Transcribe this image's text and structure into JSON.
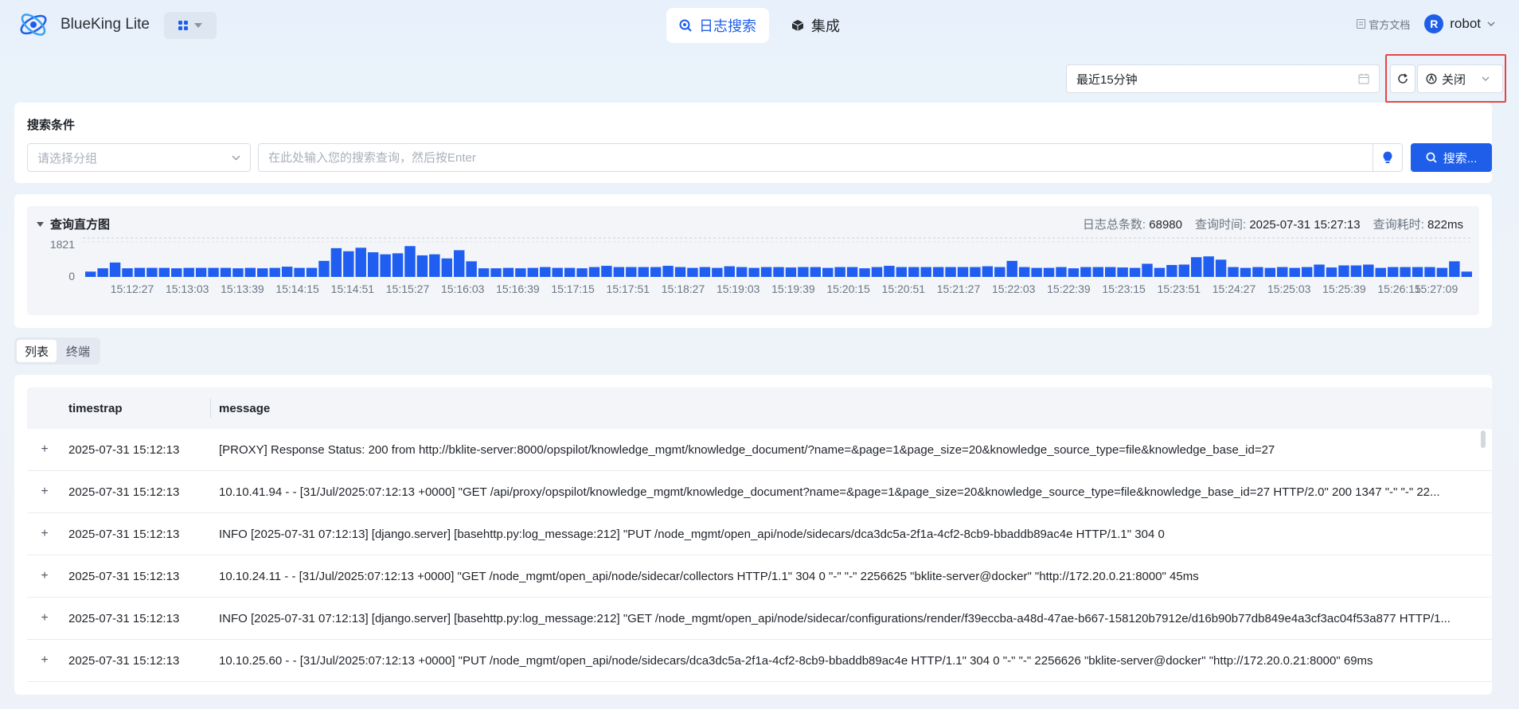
{
  "brand": {
    "name": "BlueKing Lite"
  },
  "nav": [
    {
      "label": "日志搜索",
      "icon": "search-log-icon",
      "active": true
    },
    {
      "label": "集成",
      "icon": "cube-icon",
      "active": false
    }
  ],
  "top_right": {
    "doc_label": "官方文档",
    "user_initial": "R",
    "user_name": "robot"
  },
  "time_range": {
    "value": "最近15分钟"
  },
  "auto_refresh": {
    "value": "关闭"
  },
  "search": {
    "title": "搜索条件",
    "group_placeholder": "请选择分组",
    "query_placeholder": "在此处输入您的搜索查询，然后按Enter",
    "button_label": "搜索..."
  },
  "histogram": {
    "title": "查询直方图",
    "total_label": "日志总条数:",
    "total_value": "68980",
    "query_time_label": "查询时间:",
    "query_time_value": "2025-07-31 15:27:13",
    "elapsed_label": "查询耗时:",
    "elapsed_value": "822ms",
    "y_max_label": "1821",
    "y_min_label": "0"
  },
  "chart_data": {
    "type": "bar",
    "ylim": [
      0,
      1821
    ],
    "x_tick_labels": [
      "15:12:27",
      "15:13:03",
      "15:13:39",
      "15:14:15",
      "15:14:51",
      "15:15:27",
      "15:16:03",
      "15:16:39",
      "15:17:15",
      "15:17:51",
      "15:18:27",
      "15:19:03",
      "15:19:39",
      "15:20:15",
      "15:20:51",
      "15:21:27",
      "15:22:03",
      "15:22:39",
      "15:23:15",
      "15:23:51",
      "15:24:27",
      "15:25:03",
      "15:25:39",
      "15:26:15",
      "15:27:09"
    ],
    "values": [
      260,
      420,
      700,
      420,
      440,
      440,
      440,
      420,
      440,
      440,
      440,
      440,
      420,
      440,
      420,
      440,
      500,
      440,
      440,
      780,
      1400,
      1250,
      1420,
      1200,
      1100,
      1150,
      1500,
      1050,
      1100,
      900,
      1300,
      760,
      420,
      420,
      440,
      420,
      440,
      480,
      440,
      440,
      420,
      480,
      540,
      480,
      480,
      480,
      480,
      540,
      480,
      440,
      480,
      440,
      520,
      480,
      440,
      480,
      480,
      460,
      480,
      480,
      440,
      480,
      480,
      420,
      480,
      540,
      480,
      480,
      480,
      480,
      480,
      480,
      480,
      520,
      480,
      780,
      480,
      440,
      440,
      480,
      420,
      480,
      480,
      480,
      460,
      440,
      640,
      440,
      580,
      600,
      960,
      1000,
      840,
      480,
      440,
      480,
      440,
      480,
      440,
      480,
      600,
      460,
      560,
      560,
      600,
      440,
      480,
      480,
      480,
      480,
      440,
      760,
      260
    ]
  },
  "view_tabs": [
    {
      "label": "列表",
      "active": true
    },
    {
      "label": "终端",
      "active": false
    }
  ],
  "table": {
    "columns": [
      "timestrap",
      "message"
    ],
    "rows": [
      {
        "timestamp": "2025-07-31 15:12:13",
        "message": "[PROXY] Response Status: 200 from http://bklite-server:8000/opspilot/knowledge_mgmt/knowledge_document/?name=&page=1&page_size=20&knowledge_source_type=file&knowledge_base_id=27"
      },
      {
        "timestamp": "2025-07-31 15:12:13",
        "message": "10.10.41.94 - - [31/Jul/2025:07:12:13 +0000] \"GET /api/proxy/opspilot/knowledge_mgmt/knowledge_document?name=&page=1&page_size=20&knowledge_source_type=file&knowledge_base_id=27 HTTP/2.0\" 200 1347 \"-\" \"-\" 22..."
      },
      {
        "timestamp": "2025-07-31 15:12:13",
        "message": "INFO [2025-07-31 07:12:13] [django.server] [basehttp.py:log_message:212] \"PUT /node_mgmt/open_api/node/sidecars/dca3dc5a-2f1a-4cf2-8cb9-bbaddb89ac4e HTTP/1.1\" 304 0"
      },
      {
        "timestamp": "2025-07-31 15:12:13",
        "message": "10.10.24.11 - - [31/Jul/2025:07:12:13 +0000] \"GET /node_mgmt/open_api/node/sidecar/collectors HTTP/1.1\" 304 0 \"-\" \"-\" 2256625 \"bklite-server@docker\" \"http://172.20.0.21:8000\" 45ms"
      },
      {
        "timestamp": "2025-07-31 15:12:13",
        "message": "INFO [2025-07-31 07:12:13] [django.server] [basehttp.py:log_message:212] \"GET /node_mgmt/open_api/node/sidecar/configurations/render/f39eccba-a48d-47ae-b667-158120b7912e/d16b90b77db849e4a3cf3ac04f53a877 HTTP/1..."
      },
      {
        "timestamp": "2025-07-31 15:12:13",
        "message": "10.10.25.60 - - [31/Jul/2025:07:12:13 +0000] \"PUT /node_mgmt/open_api/node/sidecars/dca3dc5a-2f1a-4cf2-8cb9-bbaddb89ac4e HTTP/1.1\" 304 0 \"-\" \"-\" 2256626 \"bklite-server@docker\" \"http://172.20.0.21:8000\" 69ms"
      }
    ]
  },
  "colors": {
    "accent": "#1e5ee8",
    "highlight": "#e64545",
    "bar": "#1f5ef0"
  }
}
